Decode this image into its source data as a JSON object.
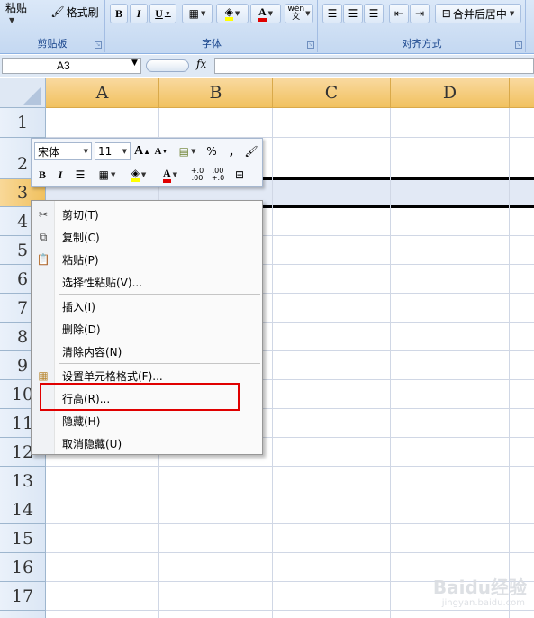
{
  "ribbon": {
    "clipboard": {
      "paste_label": "粘贴",
      "format_painter_label": "格式刷",
      "group_label": "剪贴板"
    },
    "font": {
      "bold": "B",
      "italic": "I",
      "underline": "U",
      "font_color_glyph": "A",
      "phonetic_glyph": "wén",
      "group_label": "字体",
      "font_color": "#e00000",
      "fill_color": "#ffff00"
    },
    "alignment": {
      "merge_center_label": "合并后居中",
      "group_label": "对齐方式"
    }
  },
  "formula_bar": {
    "name_box": "A3",
    "fx_label": "fx",
    "formula": ""
  },
  "sheet": {
    "columns": [
      "A",
      "B",
      "C",
      "D"
    ],
    "rows": [
      "1",
      "2",
      "3",
      "4",
      "5",
      "6",
      "7",
      "8",
      "9",
      "10",
      "11",
      "12",
      "13",
      "14",
      "15",
      "16",
      "17"
    ],
    "selected_row": "3"
  },
  "mini_toolbar": {
    "font_name": "宋体",
    "font_size": "11",
    "grow_font": "A",
    "shrink_font": "A",
    "percent": "%",
    "comma": ",",
    "bold": "B",
    "italic": "I",
    "font_color_glyph": "A",
    "inc_decimal": "+.0 .00",
    "dec_decimal": ".00 +.0"
  },
  "context_menu": {
    "items": [
      {
        "label": "剪切(T)",
        "icon": "scissors-icon"
      },
      {
        "label": "复制(C)",
        "icon": "copy-icon"
      },
      {
        "label": "粘贴(P)",
        "icon": "paste-icon"
      },
      {
        "label": "选择性粘贴(V)...",
        "icon": ""
      },
      {
        "label": "插入(I)",
        "icon": ""
      },
      {
        "label": "删除(D)",
        "icon": ""
      },
      {
        "label": "清除内容(N)",
        "icon": ""
      },
      {
        "label": "设置单元格格式(F)...",
        "icon": "format-cells-icon"
      },
      {
        "label": "行高(R)...",
        "icon": ""
      },
      {
        "label": "隐藏(H)",
        "icon": ""
      },
      {
        "label": "取消隐藏(U)",
        "icon": ""
      }
    ],
    "highlighted_item": "行高(R)..."
  },
  "watermark": {
    "main": "Baidu经验",
    "sub": "jingyan.baidu.com"
  }
}
